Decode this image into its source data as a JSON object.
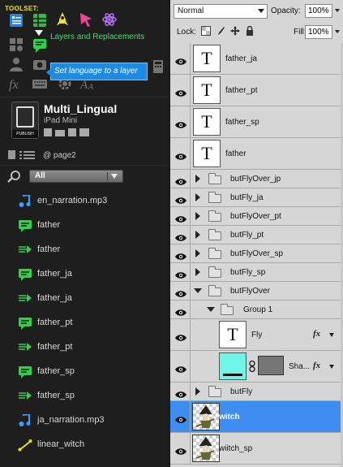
{
  "toolset": {
    "label": "TOOLSET:",
    "tooltip_layers": "Layers and Replacements",
    "tooltip_language": "Set language to a layer"
  },
  "project": {
    "title": "Multi_Lingual",
    "device": "iPad Mini",
    "publish_label": "PUBLISH",
    "page": "@ page2"
  },
  "filter": {
    "selected": "All"
  },
  "assets": [
    {
      "icon": "audio-note-icon",
      "label": "en_narration.mp3"
    },
    {
      "icon": "speech-bubble-icon",
      "label": "father"
    },
    {
      "icon": "speech-wave-icon",
      "label": "father"
    },
    {
      "icon": "speech-bubble-icon",
      "label": "father_ja"
    },
    {
      "icon": "speech-wave-icon",
      "label": "father_ja"
    },
    {
      "icon": "speech-bubble-icon",
      "label": "father_pt"
    },
    {
      "icon": "speech-wave-icon",
      "label": "father_pt"
    },
    {
      "icon": "speech-bubble-icon",
      "label": "father_sp"
    },
    {
      "icon": "speech-wave-icon",
      "label": "father_sp"
    },
    {
      "icon": "audio-note-icon",
      "label": "ja_narration.mp3"
    },
    {
      "icon": "motion-path-icon",
      "label": "linear_witch"
    }
  ],
  "layers_panel": {
    "blend_mode": "Normal",
    "opacity_label": "Opacity:",
    "opacity": "100%",
    "lock_label": "Lock:",
    "fill_label": "Fill:",
    "fill": "100%",
    "layers": [
      {
        "kind": "text",
        "name": "father_ja"
      },
      {
        "kind": "text",
        "name": "father_pt"
      },
      {
        "kind": "text",
        "name": "father_sp"
      },
      {
        "kind": "text",
        "name": "father"
      },
      {
        "kind": "group",
        "name": "butFlyOver_jp"
      },
      {
        "kind": "group",
        "name": "butFly_ja"
      },
      {
        "kind": "group",
        "name": "butFlyOver_pt"
      },
      {
        "kind": "group",
        "name": "butFly_pt"
      },
      {
        "kind": "group",
        "name": "butFlyOver_sp"
      },
      {
        "kind": "group",
        "name": "butFly_sp"
      },
      {
        "kind": "group-open",
        "name": "butFlyOver"
      },
      {
        "kind": "subgroup-open",
        "name": "Group 1"
      },
      {
        "kind": "text-fx",
        "name": "Fly",
        "fx": "fx"
      },
      {
        "kind": "shape-fx",
        "name": "Sha...",
        "fx": "fx",
        "swatch": "#6ef5e6"
      },
      {
        "kind": "group",
        "name": "butFly"
      },
      {
        "kind": "image",
        "name": "witch",
        "selected": true
      },
      {
        "kind": "image",
        "name": "wiitch_sp"
      }
    ]
  },
  "colors": {
    "toolset_label": "#f0e000",
    "tooltip_blue": "#1f8be0",
    "selection": "#3d8ef0",
    "bubble_green": "#2ed14a",
    "audio_blue": "#3aa0ff",
    "path_yellow": "#e8e020"
  }
}
